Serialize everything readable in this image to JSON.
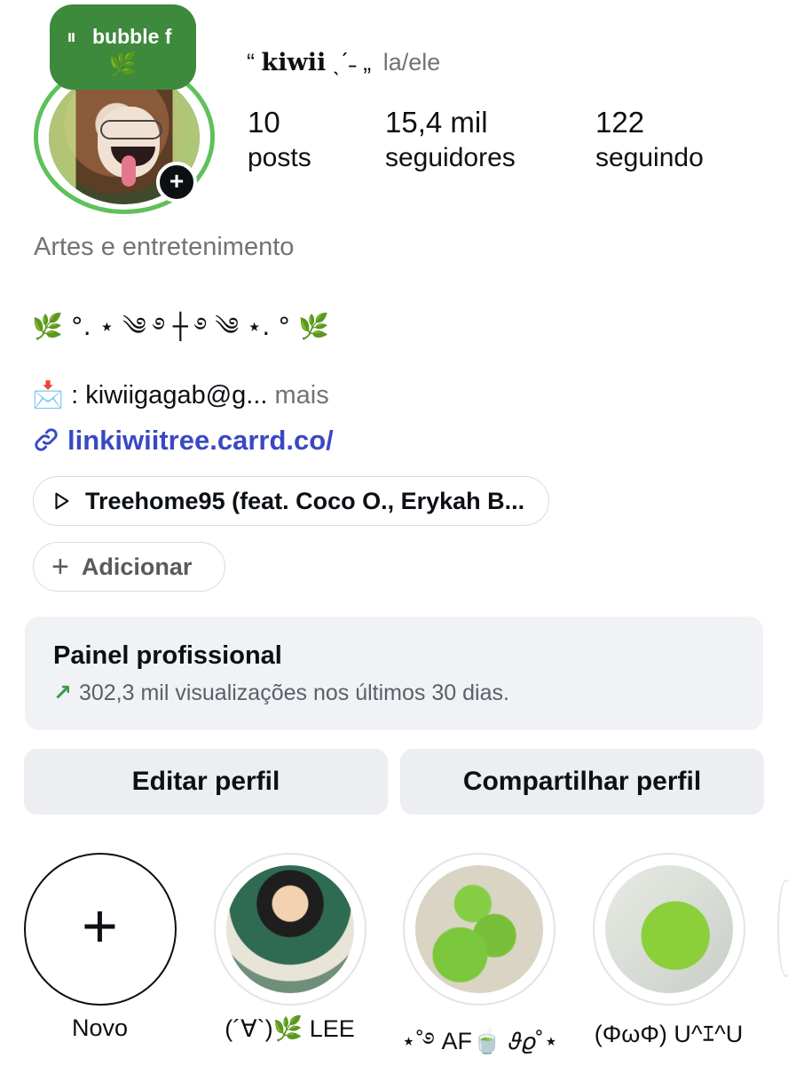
{
  "profile": {
    "note_text": "bubble f",
    "note_emoji": "🌿",
    "display_name_prefix": "“",
    "display_name": "kiwii",
    "display_name_suffix": "ˎˊ˗ „",
    "pronouns": "la/ele",
    "add_story_symbol": "+"
  },
  "stats": {
    "posts_count": "10",
    "posts_label": "posts",
    "followers_count": "15,4 mil",
    "followers_label": "seguidores",
    "following_count": "122",
    "following_label": "seguindo"
  },
  "bio": {
    "category": "Artes e entretenimento",
    "decoration": "🌿 °. ⋆ ༄ ࿔ ┼ ࿔ ༄ ⋆. ° 🌿",
    "email_icon": "📩",
    "email_text": ": kiwiigagab@g...",
    "more_label": "mais",
    "link_text": "linkiwiitree.carrd.co/"
  },
  "music": {
    "track": "Treehome95 (feat. Coco O., Erykah B..."
  },
  "add_button": {
    "symbol": "+",
    "label": "Adicionar"
  },
  "dashboard": {
    "title": "Painel profissional",
    "arrow": "↗",
    "subtitle": "302,3 mil visualizações nos últimos 30 dias."
  },
  "actions": {
    "edit_label": "Editar perfil",
    "share_label": "Compartilhar perfil"
  },
  "highlights": [
    {
      "label": "Novo",
      "symbol": "+"
    },
    {
      "label": "(´∀`)🌿 LEE"
    },
    {
      "label": "⋆˚࿔ AF🍵 𝜗𝜚˚⋆"
    },
    {
      "label": "(ΦωΦ) U^ｴ^U"
    }
  ],
  "colors": {
    "accent_green": "#5ec15a",
    "note_green": "#3d8a3d",
    "link_blue": "#3a48c4",
    "button_bg": "#eceef2"
  }
}
